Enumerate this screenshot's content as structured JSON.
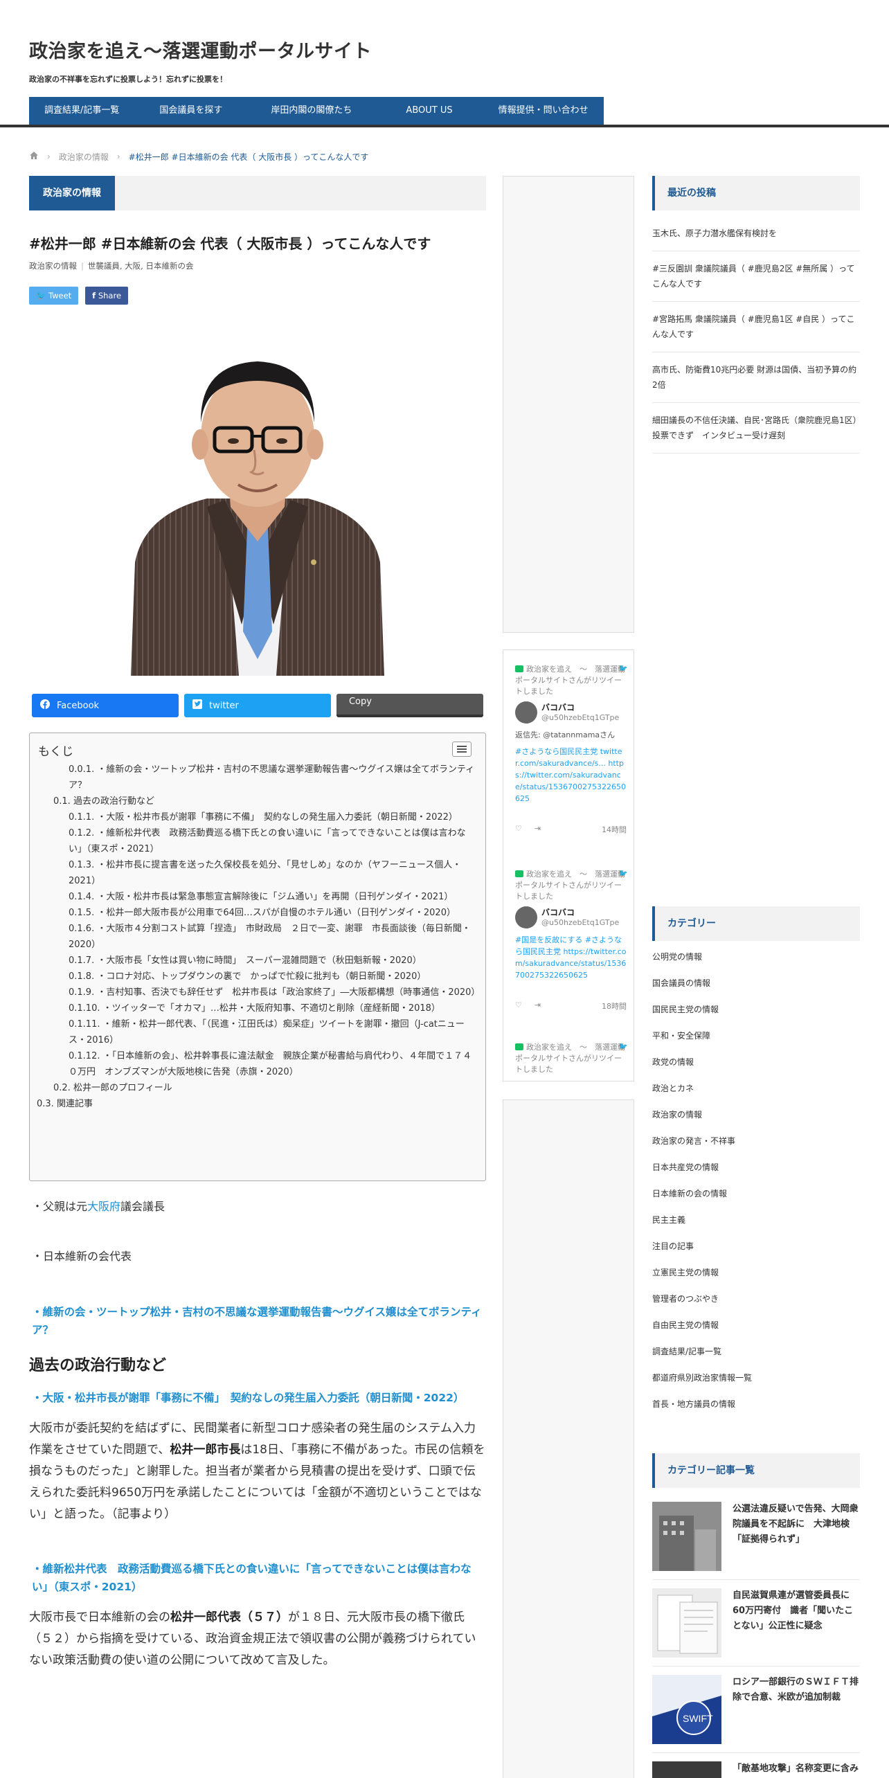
{
  "site": {
    "title": "政治家を追え〜落選運動ポータルサイト",
    "tagline": "政治家の不祥事を忘れずに投票しよう！忘れずに投票を！"
  },
  "nav": [
    "調査結果/記事一覧",
    "国会議員を探す",
    "岸田内閣の閣僚たち",
    "ABOUT US",
    "情報提供・問い合わせ"
  ],
  "breadcrumb": {
    "category": "政治家の情報",
    "current": "#松井一郎 #日本維新の会 代表（ 大阪市長 ）ってこんな人です"
  },
  "post": {
    "category_label": "政治家の情報",
    "title": "#松井一郎 #日本維新の会 代表（ 大阪市長 ）ってこんな人です",
    "meta_category": "政治家の情報",
    "meta_tags": "世襲議員, 大阪, 日本維新の会",
    "tweet_label": "Tweet",
    "share_label": "Share"
  },
  "share_buttons": {
    "facebook": "Facebook",
    "twitter": "twitter",
    "copy": "Copy"
  },
  "toc": {
    "title": "もくじ",
    "items": [
      {
        "level": 3,
        "text": "0.0.1. ・維新の会・ツートップ松井・吉村の不思議な選挙運動報告書～ウグイス嬢は全てボランティア？"
      },
      {
        "level": 2,
        "text": "0.1. 過去の政治行動など"
      },
      {
        "level": 3,
        "text": "0.1.1. ・大阪・松井市長が謝罪「事務に不備」　契約なしの発生届入力委託（朝日新聞・2022）"
      },
      {
        "level": 3,
        "text": "0.1.2. ・維新松井代表　政務活動費巡る橋下氏との食い違いに「言ってできないことは僕は言わない」（東スポ・2021）"
      },
      {
        "level": 3,
        "text": "0.1.3. ・松井市長に提言書を送った久保校長を処分、「見せしめ」なのか（ヤフーニュース個人・2021）"
      },
      {
        "level": 3,
        "text": "0.1.4. ・大阪・松井市長は緊急事態宣言解除後に「ジム通い」を再開（日刊ゲンダイ・2021）"
      },
      {
        "level": 3,
        "text": "0.1.5. ・松井一郎大阪市長が公用車で64回…スパが自慢のホテル通い（日刊ゲンダイ・2020）"
      },
      {
        "level": 3,
        "text": "0.1.6. ・大阪市４分割コスト試算「捏造」　市財政局　２日で一変、謝罪　市長面談後（毎日新聞・2020）"
      },
      {
        "level": 3,
        "text": "0.1.7. ・大阪市長「女性は買い物に時間」　スーパー混雑問題で（秋田魁新報・2020）"
      },
      {
        "level": 3,
        "text": "0.1.8. ・コロナ対応、トップダウンの裏で　かっぱで忙殺に批判も（朝日新聞・2020）"
      },
      {
        "level": 3,
        "text": "0.1.9. ・吉村知事、否決でも辞任せず　松井市長は「政治家終了」―大阪都構想（時事通信・2020）"
      },
      {
        "level": 3,
        "text": "0.1.10. ・ツイッターで「オカマ」…松井・大阪府知事、不適切と削除（産経新聞・2018）"
      },
      {
        "level": 3,
        "text": "0.1.11. ・維新・松井一郎代表、「（民進・江田氏は）痴呆症」ツイートを謝罪・撤回（J-catニュース・2016）"
      },
      {
        "level": 3,
        "text": "0.1.12. ・「日本維新の会」、松井幹事長に違法献金　親族企業が秘書給与肩代わり、４年間で１７４０万円　オンブズマンが大阪地検に告発（赤旗・2020）"
      },
      {
        "level": 2,
        "text": "0.2. 松井一郎のプロフィール"
      },
      {
        "level": 1,
        "text": "0.3. 関連記事"
      }
    ]
  },
  "body": {
    "father_prefix": "・父親は元",
    "father_link": "大阪府",
    "father_suffix": "議会議長",
    "party_line": "・日本維新の会代表",
    "link_report": "・維新の会・ツートップ松井・吉村の不思議な選挙運動報告書～ウグイス嬢は全てボランティア？",
    "heading_past": "過去の政治行動など",
    "link_news1": "・大阪・松井市長が謝罪「事務に不備」　契約なしの発生届入力委託（朝日新聞・2022）",
    "para1_a": "大阪市が委託契約を結ばずに、民間業者に新型コロナ感染者の発生届のシステム入力作業をさせていた問題で、",
    "para1_bold": "松井一郎市長",
    "para1_b": "は18日、「事務に不備があった。市民の信頼を損なうものだった」と謝罪した。担当者が業者から見積書の提出を受けず、口頭で伝えられた委託料9650万円を承諾したことについては「金額が不適切ということではない」と語った。（記事より）",
    "link_news2": "・維新松井代表　政務活動費巡る橋下氏との食い違いに「言ってできないことは僕は言わない」（東スポ・2021）",
    "para2_a": "大阪市長で日本維新の会の",
    "para2_bold": "松井一郎代表（５７）",
    "para2_b": "が１８日、元大阪市長の橋下徹氏（５２）から指摘を受けている、政治資金規正法で領収書の公開が義務づけられていない政策活動費の使い道の公開について改めて言及した。"
  },
  "twitter_widget": {
    "tweets": [
      {
        "retweet_line": "政治家を追え　～　落選運動ポータルサイトさんがリツイートしました",
        "name": "バコバコ",
        "handle": "@u50hzebEtq1GTpe",
        "reply_to": "返信先: @tatannmamaさん",
        "body": "#さようなら国民民主党 twitter.com/sakuradvance/s... https://twitter.com/sakuradvance/status/1536700275322650625",
        "time": "14時間"
      },
      {
        "retweet_line": "政治家を追え　～　落選運動ポータルサイトさんがリツイートしました",
        "name": "バコバコ",
        "handle": "@u50hzebEtq1GTpe",
        "reply_to": "",
        "body": "#国是を反故にする #さようなら国民民主党 https://twitter.com/sakuradvance/status/1536700275322650625",
        "time": "18時間"
      },
      {
        "retweet_line": "政治家を追え　～　落選運動ポータルサイトさんがリツイートしました",
        "name": "",
        "handle": "",
        "reply_to": "",
        "body": "",
        "time": ""
      }
    ]
  },
  "sidebar": {
    "recent_title": "最近の投稿",
    "recent_posts": [
      "玉木氏、原子力潜水艦保有検討を",
      "#三反園訓 衆議院議員（ #鹿児島2区 #無所属 ）ってこんな人です",
      "#宮路拓馬 衆議院議員（ #鹿児島1区 #自民 ）ってこんな人です",
      "高市氏、防衛費10兆円必要 財源は国債、当初予算の約2倍",
      "細田議長の不信任決議、自民･宮路氏（衆院鹿児島1区）投票できず　インタビュー受け遅刻"
    ],
    "category_title": "カテゴリー",
    "categories": [
      "公明党の情報",
      "国会議員の情報",
      "国民民主党の情報",
      "平和・安全保障",
      "政党の情報",
      "政治とカネ",
      "政治家の情報",
      "政治家の発言・不祥事",
      "日本共産党の情報",
      "日本維新の会の情報",
      "民主主義",
      "注目の記事",
      "立憲民主党の情報",
      "管理者のつぶやき",
      "自由民主党の情報",
      "調査結果/記事一覧",
      "都道府県別政治家情報一覧",
      "首長・地方議員の情報"
    ],
    "cat_articles_title": "カテゴリー記事一覧",
    "cat_articles": [
      "公選法違反疑いで告発、大岡衆院議員を不起訴に　大津地検「証拠得られず」",
      "自民滋賀県連が選管委員長に60万円寄付　識者「聞いたことない」公正性に疑念",
      "ロシア一部銀行のＳＷＩＦＴ排除で合意、米欧が追加制裁",
      "「敵基地攻撃」名称変更に含み"
    ]
  },
  "colors": {
    "brand": "#1f5a94",
    "link": "#1f8fcf",
    "facebook": "#1877f2",
    "twitter": "#1da1f2"
  }
}
